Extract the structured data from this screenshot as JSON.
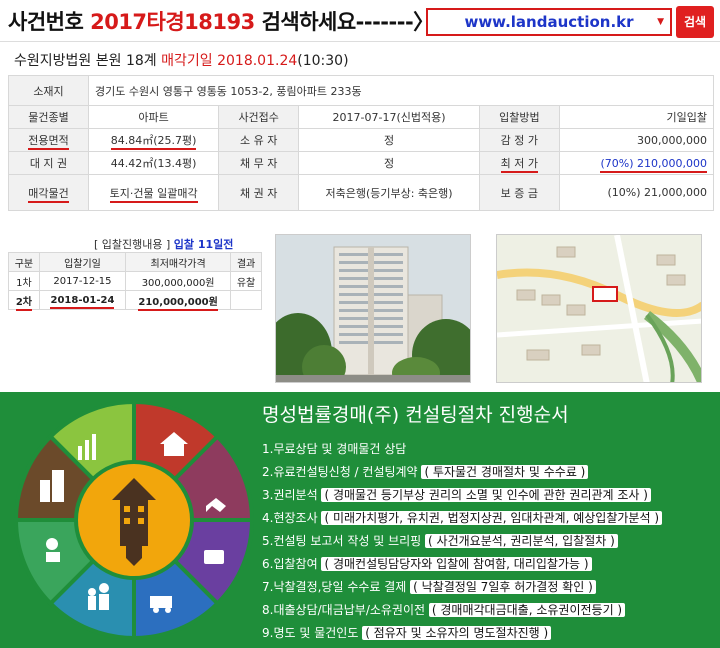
{
  "header": {
    "case_label": "사건번호",
    "case_number": "2017타경18193",
    "case_tail": "검색하세요-------〉",
    "site_url": "www.landauction.kr",
    "search_label": "검색"
  },
  "court": {
    "court_name": "수원지방법원",
    "branch": "본원",
    "dept": "18계",
    "sale_label": "매각기일",
    "sale_date": "2018.01.24",
    "sale_time": "(10:30)"
  },
  "info": {
    "location_key": "소재지",
    "location_val": "경기도 수원시 영통구 영통동 1053-2, 풍림아파트 233동",
    "rows": [
      {
        "k1": "물건종별",
        "v1": "아파트",
        "k2": "사건접수",
        "v2": "2017-07-17(신법적용)",
        "k3": "입찰방법",
        "v3": "기일입찰"
      },
      {
        "k1": "전용면적",
        "v1": "84.84㎡(25.7평)",
        "k2": "소 유 자",
        "v2": "정",
        "k3": "감 정 가",
        "v3": "300,000,000"
      },
      {
        "k1": "대 지 권",
        "v1": "44.42㎡(13.4평)",
        "k2": "채 무 자",
        "v2": "정",
        "k3": "최 저 가",
        "v3": "(70%) 210,000,000"
      },
      {
        "k1": "매각물건",
        "v1": "토지·건물 일괄매각",
        "k2": "채 권 자",
        "v2": "저축은행(등기부상: 축은행)",
        "k3": "보 증 금",
        "v3": "(10%) 21,000,000"
      }
    ]
  },
  "bid": {
    "heading": "[ 입찰진행내용 ]",
    "count": "입찰 11일전",
    "columns": [
      "구분",
      "입찰기일",
      "최저매각가격",
      "결과"
    ],
    "rows": [
      {
        "round": "1차",
        "date": "2017-12-15",
        "price": "300,000,000원",
        "result": "유찰"
      },
      {
        "round": "2차",
        "date": "2018-01-24",
        "price": "210,000,000원",
        "result": ""
      }
    ]
  },
  "process": {
    "title": "명성법률경매(주) 컨설팅절차 진행순서",
    "steps": [
      {
        "main": "1.무료상담 및 경매물건 상담",
        "hl": ""
      },
      {
        "main": "2.유료컨설팅신청 / 컨설팅계약",
        "hl": "( 투자물건 경매절차 및 수수료 )"
      },
      {
        "main": "3.권리분석",
        "hl": "( 경매물건 등기부상 권리의 소멸 및 인수에 관한 권리관계 조사 )"
      },
      {
        "main": "4.현장조사",
        "hl": "( 미래가치평가, 유치권, 법정지상권, 임대차관계, 예상입찰가분석 )"
      },
      {
        "main": "5.컨설팅 보고서 작성 및 브리핑",
        "hl": "( 사건개요분석, 권리분석, 입찰절차 )"
      },
      {
        "main": "6.입찰참여",
        "hl": "( 경매컨설팅담당자와 입찰에 참여함, 대리입찰가능 )"
      },
      {
        "main": "7.낙찰결정,당일 수수료 결제",
        "hl": "( 낙찰결정일 7일후 허가결정 확인 )"
      },
      {
        "main": "8.대출상담/대금납부/소유권이전",
        "hl": "( 경매매각대금대출, 소유권이전등기 )"
      },
      {
        "main": "9.명도 및 물건인도",
        "hl": "( 점유자 및 소유자의 명도절차진행 )"
      }
    ]
  },
  "colors": {
    "accent_red": "#d61a1a",
    "link_blue": "#1d35c8",
    "green_bg": "#1f8e3a"
  }
}
